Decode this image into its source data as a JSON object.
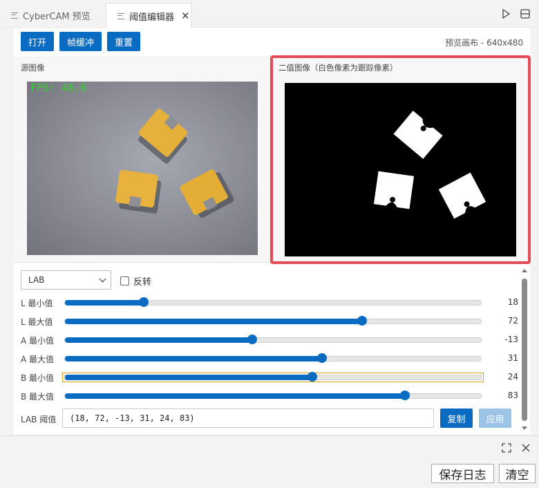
{
  "tabs": [
    {
      "label": "CyberCAM 预览",
      "active": false
    },
    {
      "label": "阈值编辑器",
      "active": true
    }
  ],
  "toolbar": {
    "open": "打开",
    "framebuffer": "帧缓冲",
    "reset": "重置"
  },
  "canvas_info": "预览画布 - 640x480",
  "source": {
    "label": "源图像",
    "fps": "FPS: 46.6"
  },
  "binary": {
    "label": "二值图像（白色像素为跟踪像素）"
  },
  "colors": {
    "accent": "#0a6bc2",
    "highlight": "#e34c55",
    "fps_text": "#2bd82b",
    "focus_outline": "#d4a017"
  },
  "mode": {
    "selected": "LAB",
    "invert_label": "反转",
    "invert_checked": false
  },
  "sliders": [
    {
      "label": "L 最小值",
      "value": "18",
      "fraction": 0.19
    },
    {
      "label": "L 最大值",
      "value": "72",
      "fraction": 0.715
    },
    {
      "label": "A 最小值",
      "value": "-13",
      "fraction": 0.45
    },
    {
      "label": "A 最大值",
      "value": "31",
      "fraction": 0.618
    },
    {
      "label": "B 最小值",
      "value": "24",
      "fraction": 0.595,
      "focused": true
    },
    {
      "label": "B 最大值",
      "value": "83",
      "fraction": 0.818
    }
  ],
  "lab": {
    "label": "LAB 阈值",
    "value": "(18, 72, -13, 31, 24, 83)",
    "copy": "复制",
    "apply": "应用"
  },
  "log": {
    "save": "保存日志",
    "clear": "清空"
  }
}
